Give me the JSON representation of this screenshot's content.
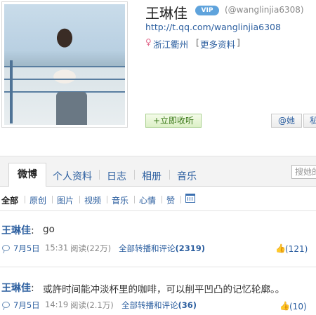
{
  "profile": {
    "name": "王琳佳",
    "vip_label": "VIP",
    "handle": "(@wanglinjia6308)",
    "url": "http://t.qq.com/wanglinjia6308",
    "location_icon": "female-icon",
    "location": "浙江衢州",
    "more_info": "更多资料",
    "follow_button": "+立即收听",
    "at_button": "@她",
    "message_button": "私"
  },
  "tabs": [
    {
      "label": "微博",
      "active": true
    },
    {
      "label": "个人资料"
    },
    {
      "label": "日志"
    },
    {
      "label": "相册"
    },
    {
      "label": "音乐"
    }
  ],
  "search": {
    "placeholder": "搜她的"
  },
  "filters": [
    "全部",
    "原创",
    "图片",
    "视频",
    "音乐",
    "心情",
    "赞"
  ],
  "posts": [
    {
      "author": "王琳佳",
      "text": "go",
      "date": "7月5日",
      "time": "15:31",
      "reads": "阅读(22万)",
      "repost_label": "全部转播和评论",
      "repost_count": "(2319)",
      "likes": "(121)"
    },
    {
      "author": "王琳佳",
      "text": "或許时间能冲淡杯里的咖啡，可以削平凹凸的记忆轮廓。。",
      "date": "7月5日",
      "time": "14:19",
      "reads": "阅读(2.1万)",
      "repost_label": "全部转播和评论",
      "repost_count": "(36)",
      "likes": "(10)"
    }
  ],
  "colors": {
    "link": "#2b5e9f",
    "follow_green": "#3c7a1b",
    "vip_blue": "#5fa3dc"
  }
}
